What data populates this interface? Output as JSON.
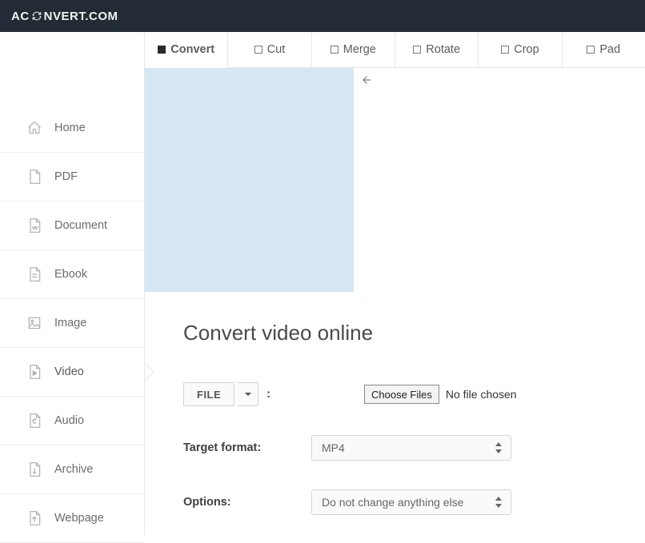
{
  "brand": {
    "pre": "AC",
    "post": "NVERT.COM"
  },
  "sidebar": {
    "items": [
      {
        "label": "Home"
      },
      {
        "label": "PDF"
      },
      {
        "label": "Document"
      },
      {
        "label": "Ebook"
      },
      {
        "label": "Image"
      },
      {
        "label": "Video"
      },
      {
        "label": "Audio"
      },
      {
        "label": "Archive"
      },
      {
        "label": "Webpage"
      }
    ]
  },
  "tabs": [
    {
      "label": "Convert"
    },
    {
      "label": "Cut"
    },
    {
      "label": "Merge"
    },
    {
      "label": "Rotate"
    },
    {
      "label": "Crop"
    },
    {
      "label": "Pad"
    }
  ],
  "page": {
    "title": "Convert video online",
    "file_button": "FILE",
    "colon": ":",
    "choose_files": "Choose Files",
    "no_file": "No file chosen",
    "target_label": "Target format:",
    "target_value": "MP4",
    "options_label": "Options:",
    "options_value": "Do not change anything else"
  }
}
